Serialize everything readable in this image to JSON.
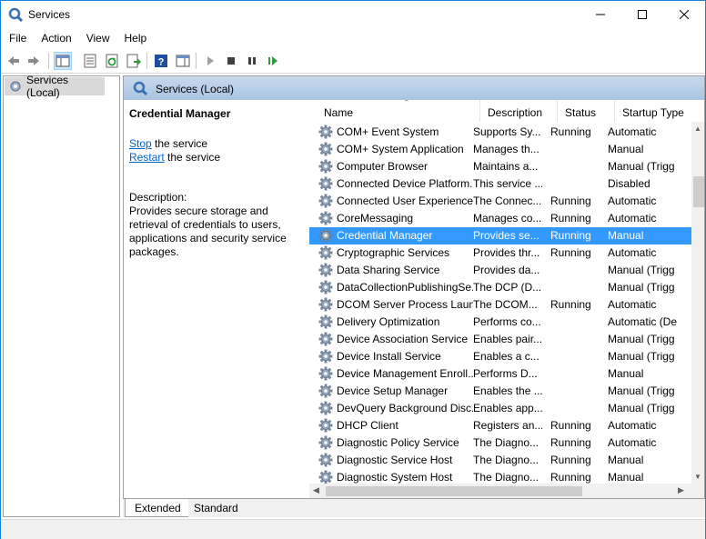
{
  "window": {
    "title": "Services"
  },
  "menu": [
    "File",
    "Action",
    "View",
    "Help"
  ],
  "toolbar": {
    "icons": [
      "back-icon",
      "forward-icon",
      "show-hide-tree-icon",
      "properties-icon",
      "refresh-icon",
      "export-list-icon",
      "help-icon",
      "show-hide-action-pane-icon",
      "start-service-icon",
      "stop-service-icon",
      "pause-service-icon",
      "resume-service-icon"
    ]
  },
  "tree": {
    "root_label": "Services (Local)"
  },
  "main": {
    "header_title": "Services (Local)",
    "selected_name": "Credential Manager",
    "stop_link": "Stop",
    "stop_suffix": " the service",
    "restart_link": "Restart",
    "restart_suffix": " the service",
    "description_label": "Description:",
    "description_text": "Provides secure storage and retrieval of credentials to users, applications and security service packages."
  },
  "list": {
    "columns": [
      "Name",
      "Description",
      "Status",
      "Startup Type"
    ],
    "sorted_column": "Name",
    "selected_row": 6,
    "rows": [
      {
        "name": "COM+ Event System",
        "description": "Supports Sy...",
        "status": "Running",
        "startup": "Automatic"
      },
      {
        "name": "COM+ System Application",
        "description": "Manages th...",
        "status": "",
        "startup": "Manual"
      },
      {
        "name": "Computer Browser",
        "description": "Maintains a...",
        "status": "",
        "startup": "Manual (Trigg"
      },
      {
        "name": "Connected Device Platform...",
        "description": "This service ...",
        "status": "",
        "startup": "Disabled"
      },
      {
        "name": "Connected User Experience...",
        "description": "The Connec...",
        "status": "Running",
        "startup": "Automatic"
      },
      {
        "name": "CoreMessaging",
        "description": "Manages co...",
        "status": "Running",
        "startup": "Automatic"
      },
      {
        "name": "Credential Manager",
        "description": "Provides se...",
        "status": "Running",
        "startup": "Manual"
      },
      {
        "name": "Cryptographic Services",
        "description": "Provides thr...",
        "status": "Running",
        "startup": "Automatic"
      },
      {
        "name": "Data Sharing Service",
        "description": "Provides da...",
        "status": "",
        "startup": "Manual (Trigg"
      },
      {
        "name": "DataCollectionPublishingSe...",
        "description": "The DCP (D...",
        "status": "",
        "startup": "Manual (Trigg"
      },
      {
        "name": "DCOM Server Process Laun...",
        "description": "The DCOM...",
        "status": "Running",
        "startup": "Automatic"
      },
      {
        "name": "Delivery Optimization",
        "description": "Performs co...",
        "status": "",
        "startup": "Automatic (De"
      },
      {
        "name": "Device Association Service",
        "description": "Enables pair...",
        "status": "",
        "startup": "Manual (Trigg"
      },
      {
        "name": "Device Install Service",
        "description": "Enables a c...",
        "status": "",
        "startup": "Manual (Trigg"
      },
      {
        "name": "Device Management Enroll...",
        "description": "Performs D...",
        "status": "",
        "startup": "Manual"
      },
      {
        "name": "Device Setup Manager",
        "description": "Enables the ...",
        "status": "",
        "startup": "Manual (Trigg"
      },
      {
        "name": "DevQuery Background Disc...",
        "description": "Enables app...",
        "status": "",
        "startup": "Manual (Trigg"
      },
      {
        "name": "DHCP Client",
        "description": "Registers an...",
        "status": "Running",
        "startup": "Automatic"
      },
      {
        "name": "Diagnostic Policy Service",
        "description": "The Diagno...",
        "status": "Running",
        "startup": "Automatic"
      },
      {
        "name": "Diagnostic Service Host",
        "description": "The Diagno...",
        "status": "Running",
        "startup": "Manual"
      },
      {
        "name": "Diagnostic System Host",
        "description": "The Diagno...",
        "status": "Running",
        "startup": "Manual"
      }
    ]
  },
  "tabs": [
    "Extended",
    "Standard"
  ],
  "active_tab": "Extended",
  "colors": {
    "selection": "#3399ff",
    "link": "#0066cc",
    "header_gradient_top": "#c9d9ec",
    "header_gradient_bottom": "#a9c3e1",
    "window_border": "#1883d7"
  }
}
